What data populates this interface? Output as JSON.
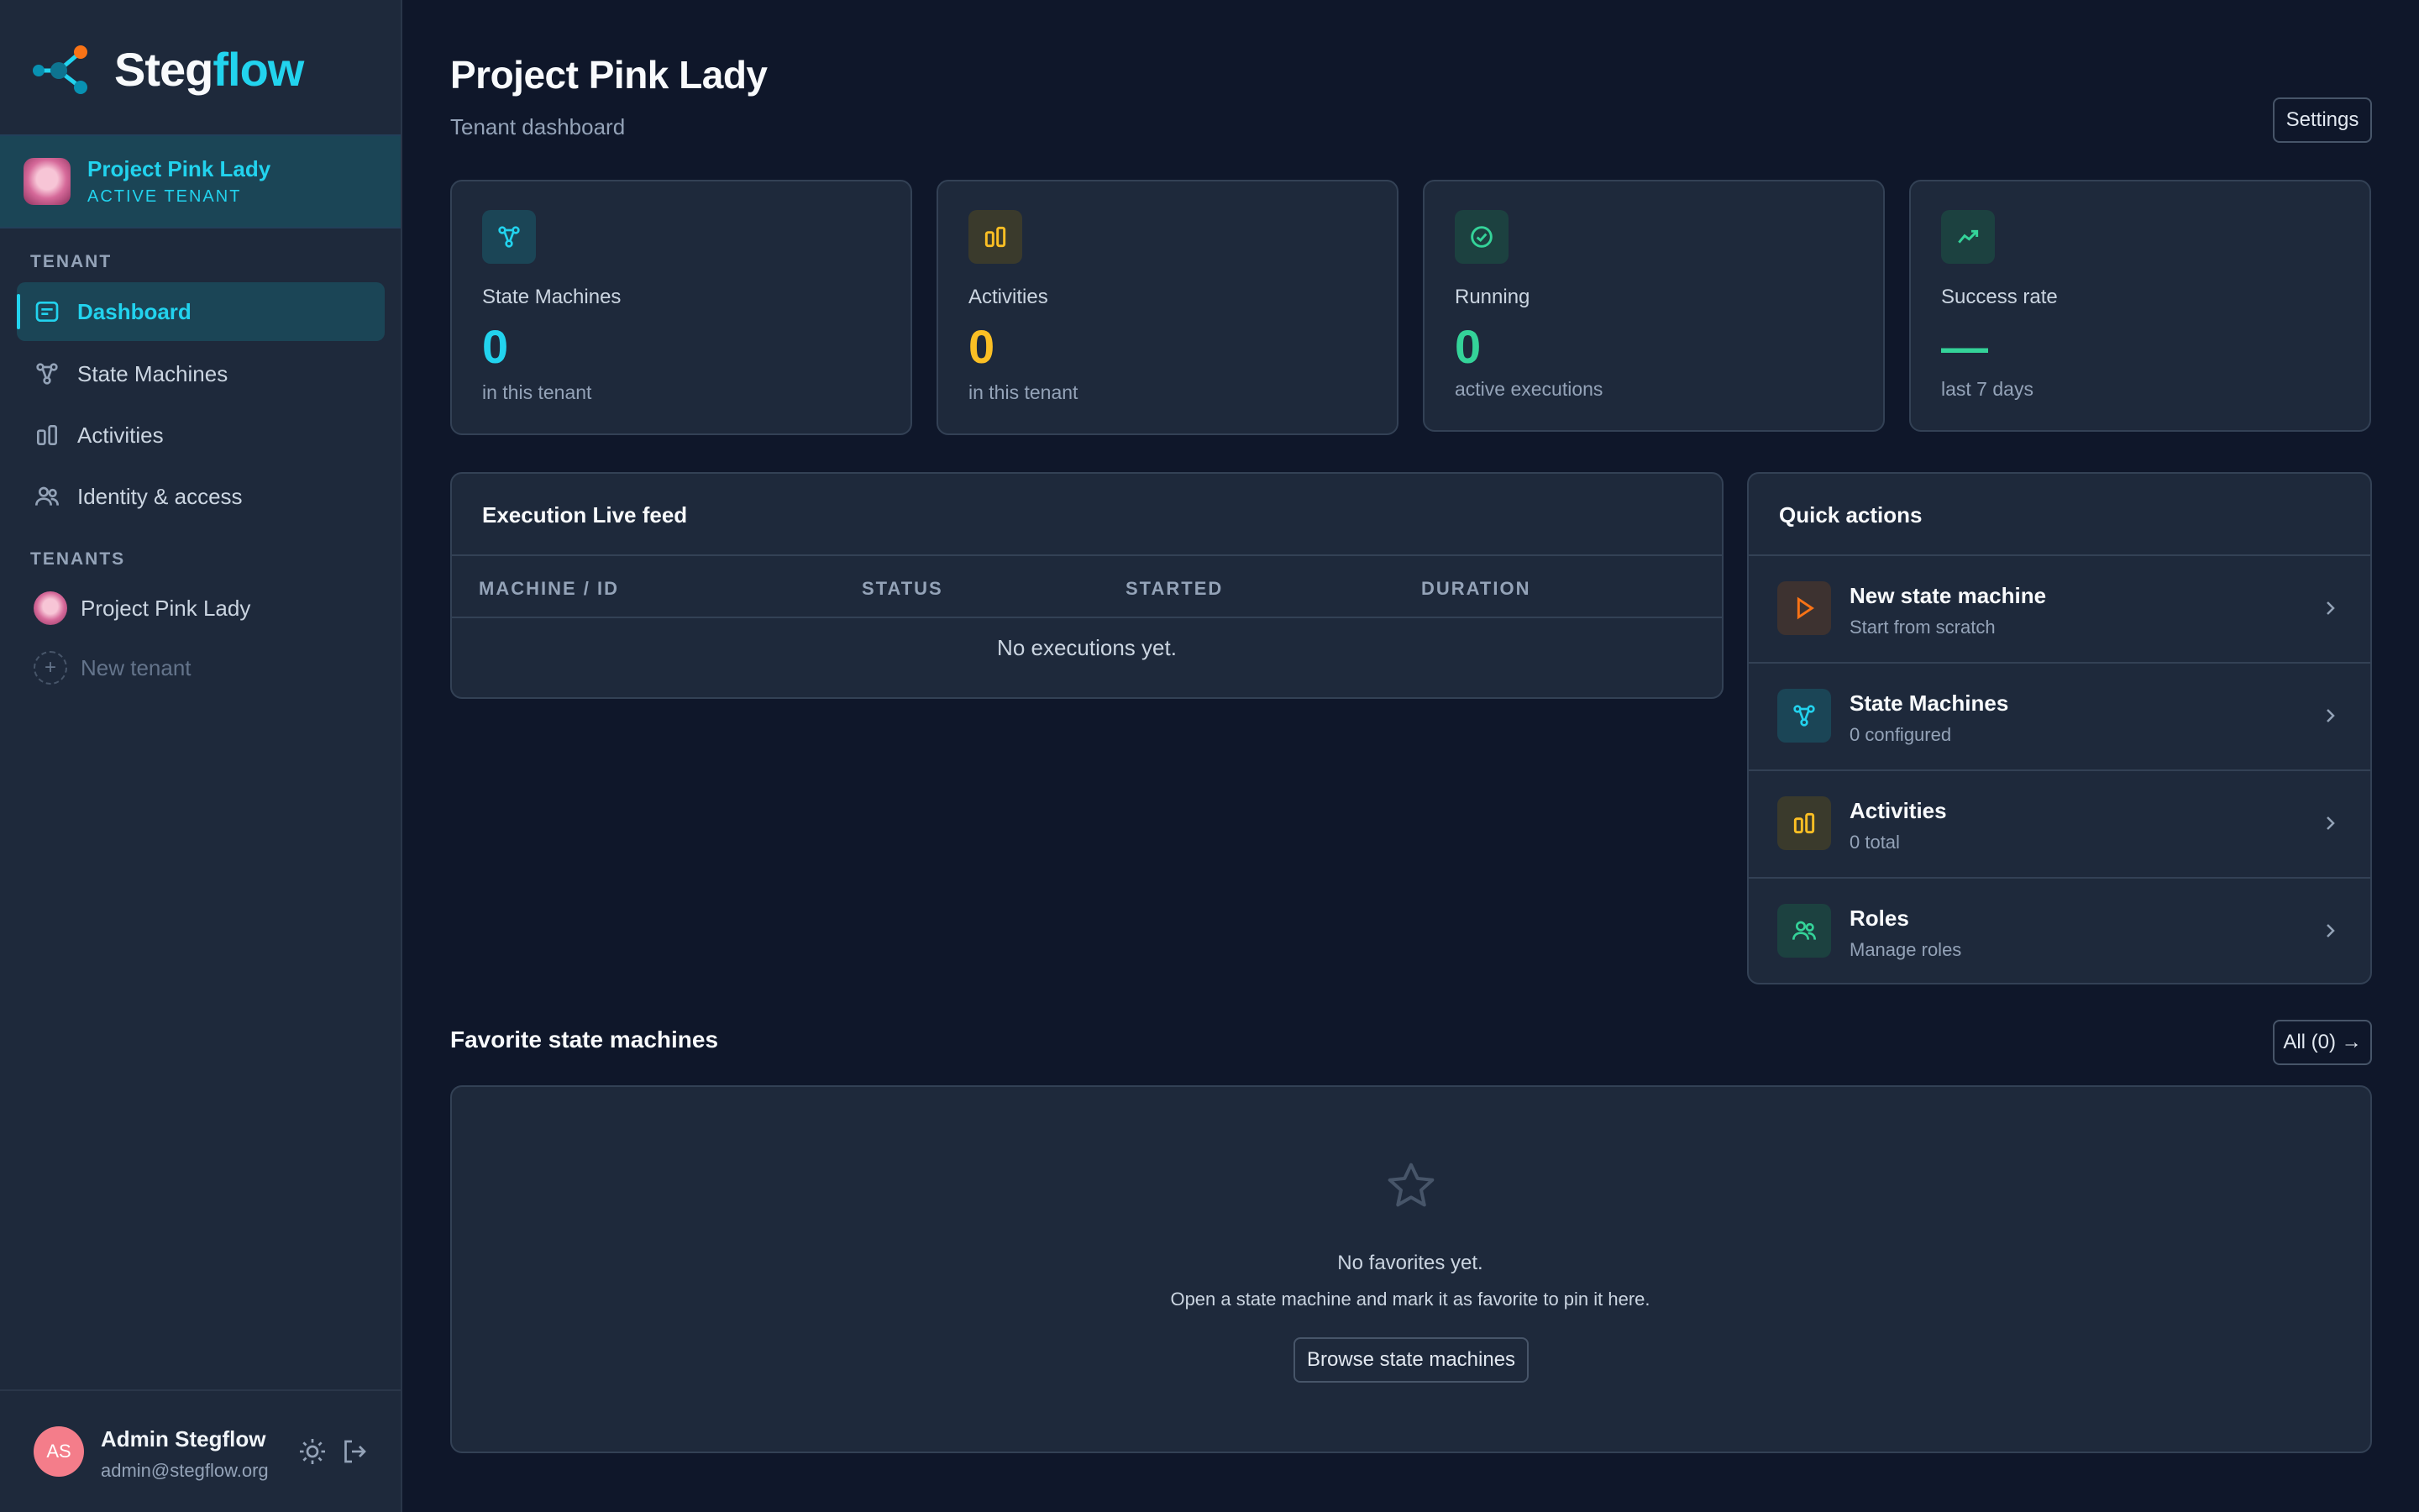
{
  "brand": {
    "name_a": "Steg",
    "name_b": "flow"
  },
  "active_tenant": {
    "name": "Project Pink Lady",
    "label": "ACTIVE TENANT"
  },
  "sidebar": {
    "tenant_section": "TENANT",
    "items": [
      {
        "label": "Dashboard",
        "icon": "dashboard-icon",
        "active": true
      },
      {
        "label": "State Machines",
        "icon": "state-machine-icon"
      },
      {
        "label": "Activities",
        "icon": "activities-icon"
      },
      {
        "label": "Identity & access",
        "icon": "users-icon"
      }
    ],
    "tenants_section": "TENANTS",
    "tenants": [
      {
        "label": "Project Pink Lady"
      }
    ],
    "new_tenant_label": "New tenant"
  },
  "user": {
    "initials": "AS",
    "name": "Admin Stegflow",
    "email": "admin@stegflow.org"
  },
  "header": {
    "title": "Project Pink Lady",
    "subtitle": "Tenant dashboard",
    "settings_label": "Settings"
  },
  "stats": [
    {
      "label": "State Machines",
      "value": "0",
      "sub": "in this tenant",
      "color": "#22d3ee",
      "icon": "state-machine-icon"
    },
    {
      "label": "Activities",
      "value": "0",
      "sub": "in this tenant",
      "color": "#fbbf24",
      "icon": "activities-icon"
    },
    {
      "label": "Running",
      "value": "0",
      "sub": "active executions",
      "color": "#34d399",
      "icon": "check-circle-icon"
    },
    {
      "label": "Success rate",
      "value": "—",
      "sub": "last 7 days",
      "color": "#34d399",
      "icon": "trend-up-icon"
    }
  ],
  "live_feed": {
    "title": "Execution Live feed",
    "columns": [
      "MACHINE / ID",
      "STATUS",
      "STARTED",
      "DURATION"
    ],
    "empty": "No executions yet."
  },
  "quick_actions": {
    "title": "Quick actions",
    "items": [
      {
        "title": "New state machine",
        "sub": "Start from scratch",
        "icon": "play-icon"
      },
      {
        "title": "State Machines",
        "sub": "0 configured",
        "icon": "state-machine-icon"
      },
      {
        "title": "Activities",
        "sub": "0 total",
        "icon": "activities-icon"
      },
      {
        "title": "Roles",
        "sub": "Manage roles",
        "icon": "users-icon"
      }
    ]
  },
  "favorites": {
    "title": "Favorite state machines",
    "all_label": "All (0) →",
    "empty": "No favorites yet.",
    "hint": "Open a state machine and mark it as favorite to pin it here.",
    "browse_label": "Browse state machines"
  }
}
